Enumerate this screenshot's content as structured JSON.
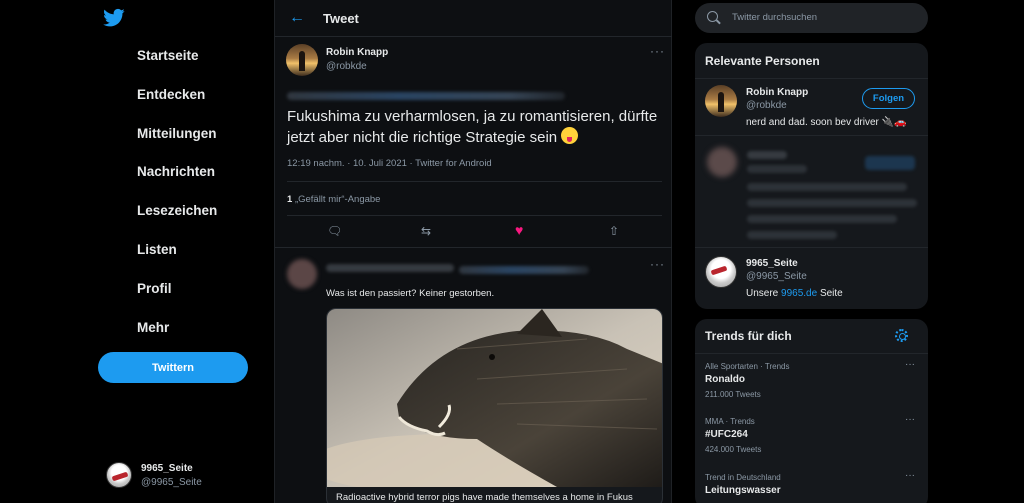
{
  "nav": {
    "items": [
      {
        "label": "Startseite"
      },
      {
        "label": "Entdecken"
      },
      {
        "label": "Mitteilungen"
      },
      {
        "label": "Nachrichten"
      },
      {
        "label": "Lesezeichen"
      },
      {
        "label": "Listen"
      },
      {
        "label": "Profil"
      },
      {
        "label": "Mehr"
      }
    ],
    "tweet_button": "Twittern",
    "account": {
      "name": "9965_Seite",
      "handle": "@9965_Seite"
    }
  },
  "header": {
    "title": "Tweet"
  },
  "tweet": {
    "author_name": "Robin Knapp",
    "author_handle": "@robkde",
    "text": "Fukushima zu verharmlosen, ja zu romantisieren, dürfte jetzt aber nicht die richtige Strategie sein",
    "meta": "12:19 nachm. · 10. Juli 2021 · Twitter for Android",
    "likes_count": "1",
    "likes_label": "„Gefällt mir“-Angabe",
    "more": "···"
  },
  "reply": {
    "text": "Was ist den passiert? Keiner gestorben.",
    "card_caption": "Radioactive hybrid terror pigs have made themselves a home in Fukus",
    "more": "···"
  },
  "search": {
    "placeholder": "Twitter durchsuchen"
  },
  "people": {
    "title": "Relevante Personen",
    "person1": {
      "name": "Robin Knapp",
      "handle": "@robkde",
      "bio": "nerd and dad. soon bev driver 🔌🚗",
      "follow": "Folgen"
    },
    "person3": {
      "name": "9965_Seite",
      "handle": "@9965_Seite",
      "bio_prefix": "Unsere ",
      "bio_link": "9965.de",
      "bio_suffix": " Seite"
    }
  },
  "trends": {
    "title": "Trends für dich",
    "items": [
      {
        "category": "Alle Sportarten · Trends",
        "name": "Ronaldo",
        "count": "211.000 Tweets"
      },
      {
        "category": "MMA · Trends",
        "name": "#UFC264",
        "count": "424.000 Tweets"
      },
      {
        "category": "Trend in Deutschland",
        "name": "Leitungswasser",
        "count": ""
      }
    ]
  },
  "colors": {
    "accent": "#1d9bf0",
    "like": "#f91880",
    "background": "#000000"
  }
}
